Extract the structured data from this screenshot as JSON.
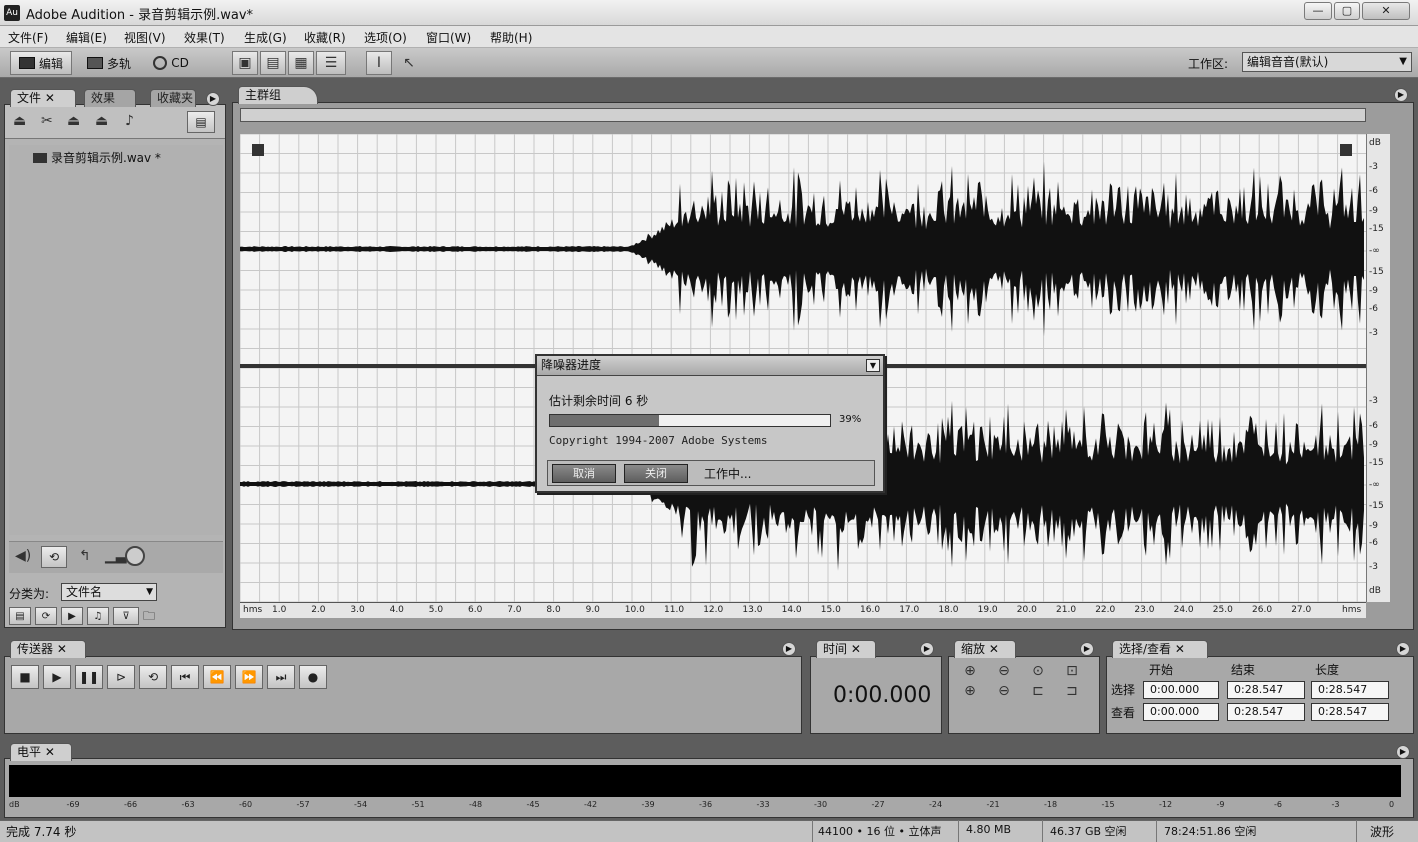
{
  "window": {
    "title": "Adobe Audition - 录音剪辑示例.wav*",
    "app_icon": "Au"
  },
  "menu": [
    "文件(F)",
    "编辑(E)",
    "视图(V)",
    "效果(T)",
    "生成(G)",
    "收藏(R)",
    "选项(O)",
    "窗口(W)",
    "帮助(H)"
  ],
  "toolbar": {
    "edit": "编辑",
    "multitrack": "多轨",
    "cd": "CD",
    "workspace_label": "工作区:",
    "workspace_value": "编辑音音(默认)"
  },
  "files_panel": {
    "tabs": [
      "文件",
      "效果",
      "收藏夹"
    ],
    "files": [
      "录音剪辑示例.wav *"
    ],
    "sort_label": "分类为:",
    "sort_value": "文件名"
  },
  "main_panel": {
    "tab": "主群组"
  },
  "wave": {
    "db_top": [
      "dB",
      "-3",
      "-6",
      "-9",
      "-15",
      "-∞",
      "-15",
      "-9",
      "-6",
      "-3"
    ],
    "db_bottom": [
      "-3",
      "-6",
      "-9",
      "-15",
      "-∞",
      "-15",
      "-9",
      "-6",
      "-3",
      "dB"
    ],
    "time_start": "hms",
    "time_ticks": [
      "1.0",
      "2.0",
      "3.0",
      "4.0",
      "5.0",
      "6.0",
      "7.0",
      "8.0",
      "9.0",
      "10.0",
      "11.0",
      "12.0",
      "13.0",
      "14.0",
      "15.0",
      "16.0",
      "17.0",
      "18.0",
      "19.0",
      "20.0",
      "21.0",
      "22.0",
      "23.0",
      "24.0",
      "25.0",
      "26.0",
      "27.0"
    ],
    "time_end": "hms"
  },
  "dialog": {
    "title": "降噪器进度",
    "remaining": "估计剩余时间  6  秒",
    "progress": 0.39,
    "progress_text": "39%",
    "copyright": "Copyright 1994-2007 Adobe Systems",
    "cancel": "取消",
    "close": "关闭",
    "status": "工作中..."
  },
  "transport": {
    "tab": "传送器"
  },
  "time_panel": {
    "tab": "时间",
    "value": "0:00.000"
  },
  "zoom_panel": {
    "tab": "缩放"
  },
  "selection_panel": {
    "tab": "选择/查看",
    "headers": [
      "开始",
      "结束",
      "长度"
    ],
    "rows": [
      {
        "label": "选择",
        "start": "0:00.000",
        "end": "0:28.547",
        "length": "0:28.547"
      },
      {
        "label": "查看",
        "start": "0:00.000",
        "end": "0:28.547",
        "length": "0:28.547"
      }
    ]
  },
  "level_panel": {
    "tab": "电平",
    "ticks": [
      "dB",
      "-69",
      "-66",
      "-63",
      "-60",
      "-57",
      "-54",
      "-51",
      "-48",
      "-45",
      "-42",
      "-39",
      "-36",
      "-33",
      "-30",
      "-27",
      "-24",
      "-21",
      "-18",
      "-15",
      "-12",
      "-9",
      "-6",
      "-3",
      "0"
    ]
  },
  "status": {
    "done": "完成 7.74 秒",
    "format": "44100 • 16 位 • 立体声",
    "size": "4.80 MB",
    "free": "46.37 GB 空闲",
    "free_time": "78:24:51.86 空闲",
    "view": "波形"
  }
}
